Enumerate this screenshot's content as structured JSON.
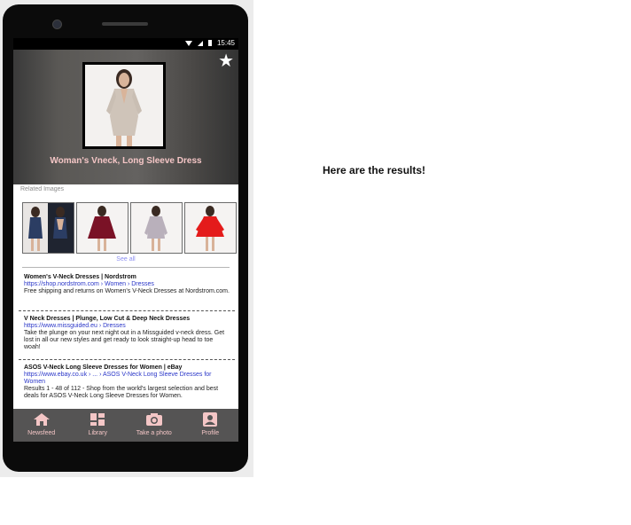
{
  "status_bar": {
    "time": "15:45"
  },
  "hero": {
    "product_title": "Woman's Vneck, Long Sleeve Dress",
    "favorite_icon": "star-icon"
  },
  "related": {
    "label": "Related Images",
    "see_all": "See all"
  },
  "results": [
    {
      "title": "Women's V-Neck Dresses | Nordstrom",
      "url": "https://shop.nordstrom.com › Women › Dresses",
      "description": "Free shipping and returns on Women's V-Neck Dresses at Nordstrom.com."
    },
    {
      "title": "V Neck Dresses | Plunge, Low Cut & Deep Neck Dresses",
      "url": "https://www.missguided.eu › Dresses",
      "description": "Take the plunge on your next night out in a Missguided v-neck dress. Get lost in all our new styles and get ready to look straight-up head to toe woah!"
    },
    {
      "title": "ASOS V-Neck Long Sleeve Dresses for Women | eBay",
      "url": "https://www.ebay.co.uk › ... › ASOS V-Neck Long Sleeve Dresses for Women",
      "description": "Results 1 - 48 of 112 - Shop from the world's largest selection and best deals for ASOS V-Neck Long Sleeve Dresses for Women."
    }
  ],
  "nav": {
    "newsfeed": "Newsfeed",
    "library": "Library",
    "take_photo": "Take a photo",
    "profile": "Profile"
  },
  "message": "Here are the results!",
  "colors": {
    "accent_pink": "#f4c6c6",
    "nav_bg": "#555454",
    "link_blue": "#2a36c8"
  }
}
